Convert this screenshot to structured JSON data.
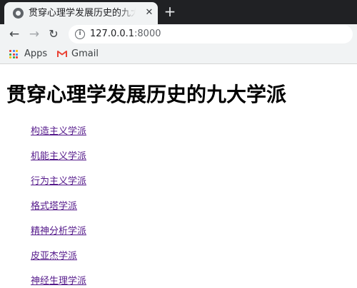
{
  "browser": {
    "tab": {
      "title": "贯穿心理学发展历史的九大学派",
      "close_glyph": "✕"
    },
    "new_tab_glyph": "+",
    "nav": {
      "back_glyph": "←",
      "forward_glyph": "→",
      "reload_glyph": "↻"
    },
    "address_bar": {
      "host": "127.0.0.1",
      "port": ":8000",
      "info_glyph": "i"
    },
    "bookmarks": [
      {
        "label": "Apps",
        "icon": "apps-grid-icon"
      },
      {
        "label": "Gmail",
        "icon": "gmail-icon"
      }
    ]
  },
  "page": {
    "heading": "贯穿心理学发展历史的九大学派",
    "links": [
      "构造主义学派",
      "机能主义学派",
      "行为主义学派",
      "格式塔学派",
      "精神分析学派",
      "皮亚杰学派",
      "神经生理学派"
    ]
  },
  "colors": {
    "tab_strip": "#202124",
    "toolbar": "#f1f3f4",
    "visited_link": "#551a8b",
    "gmail_red": "#ea4335"
  }
}
